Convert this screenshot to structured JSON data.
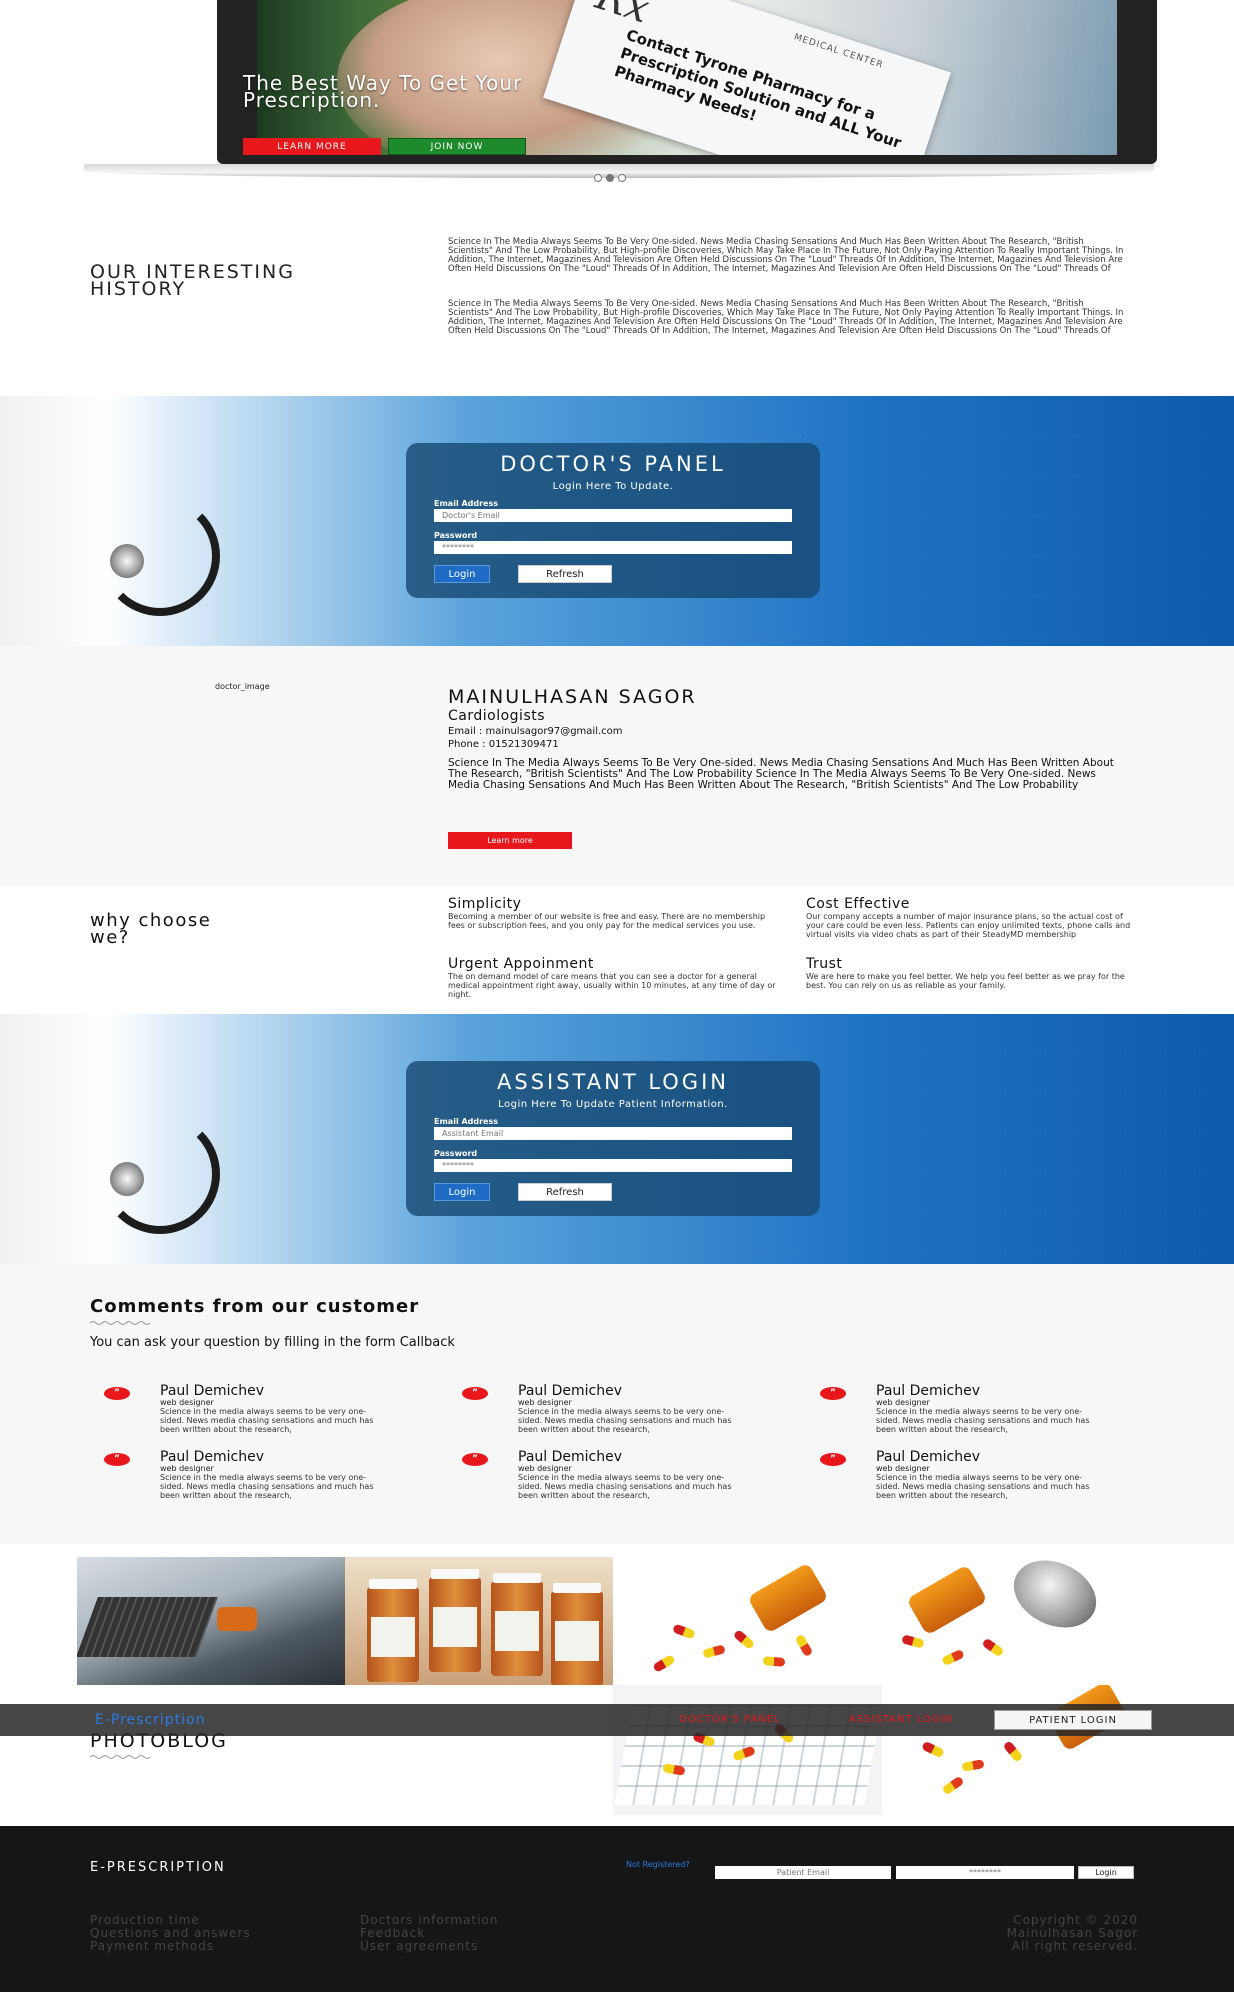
{
  "hero": {
    "title": "The Best Way To Get Your Prescription.",
    "rx_symbol": "Rx",
    "rx_header": "MEDICAL CENTER",
    "rx_text": "Contact Tyrone Pharmacy for a Prescription Solution and ALL Your Pharmacy Needs!",
    "learn_more": "LEARN MORE",
    "join_now": "JOIN NOW",
    "slides": [
      false,
      true,
      false
    ]
  },
  "history": {
    "title": "OUR INTERESTING HISTORY",
    "paragraphs": [
      "Science In The Media Always Seems To Be Very One-sided. News Media Chasing Sensations And Much Has Been Written About The Research, \"British Scientists\" And The Low Probability, But High-profile Discoveries, Which May Take Place In The Future, Not Only Paying Attention To Really Important Things. In Addition, The Internet, Magazines And Television Are Often Held Discussions On The \"Loud\" Threads Of In Addition, The Internet, Magazines And Television Are Often Held Discussions On The \"Loud\" Threads Of In Addition, The Internet, Magazines And Television Are Often Held Discussions On The \"Loud\" Threads Of",
      "Science In The Media Always Seems To Be Very One-sided. News Media Chasing Sensations And Much Has Been Written About The Research, \"British Scientists\" And The Low Probability, But High-profile Discoveries, Which May Take Place In The Future, Not Only Paying Attention To Really Important Things. In Addition, The Internet, Magazines And Television Are Often Held Discussions On The \"Loud\" Threads Of In Addition, The Internet, Magazines And Television Are Often Held Discussions On The \"Loud\" Threads Of In Addition, The Internet, Magazines And Television Are Often Held Discussions On The \"Loud\" Threads Of"
    ]
  },
  "doctor_panel": {
    "title": "DOCTOR'S PANEL",
    "subtitle": "Login Here To Update.",
    "email_label": "Email Address",
    "email_placeholder": "Doctor's Email",
    "password_label": "Password",
    "password_placeholder": "********",
    "login": "Login",
    "refresh": "Refresh"
  },
  "doctor": {
    "image_alt": "doctor_image",
    "name": "MAINULHASAN SAGOR",
    "specialty": "Cardiologists",
    "email": "Email : mainulsagor97@gmail.com",
    "phone": "Phone : 01521309471",
    "bio": "Science In The Media Always Seems To Be Very One-sided. News Media Chasing Sensations And Much Has Been Written About The Research, \"British Scientists\" And The Low Probability Science In The Media Always Seems To Be Very One-sided. News Media Chasing Sensations And Much Has Been Written About The Research, \"British Scientists\" And The Low Probability",
    "learn_more": "Learn more"
  },
  "why": {
    "title": "why choose we?",
    "features": [
      {
        "title": "Simplicity",
        "text": "Becoming a member of our website is free and easy. There are no membership fees or subscription fees, and you only pay for the medical services you use."
      },
      {
        "title": "Cost Effective",
        "text": "Our company accepts a number of major insurance plans, so the actual cost of your care could be even less. Patients can enjoy unlimited texts, phone calls and virtual visits via video chats as part of their SteadyMD membership"
      },
      {
        "title": "Urgent Appoinment",
        "text": "The on demand model of care means that you can see a doctor for a general medical appointment right away, usually within 10 minutes, at any time of day or night."
      },
      {
        "title": "Trust",
        "text": "We are here to make you feel better. We help you feel better as we pray for the best. You can rely on us as reliable as your family."
      }
    ]
  },
  "assistant_panel": {
    "title": "ASSISTANT LOGIN",
    "subtitle": "Login Here To Update Patient Information.",
    "email_label": "Email Address",
    "email_placeholder": "Assistant Email",
    "password_label": "Password",
    "password_placeholder": "********",
    "login": "Login",
    "refresh": "Refresh"
  },
  "comments": {
    "title": "Comments from our customer",
    "subtitle": "You can ask your question by filling in the form Callback",
    "quote_icon": "quote-icon",
    "items": [
      {
        "name": "Paul Demichev",
        "role": "web designer",
        "text": "Science in the media always seems to be very one-sided. News media chasing sensations and much has been written about the research,"
      },
      {
        "name": "Paul Demichev",
        "role": "web designer",
        "text": "Science in the media always seems to be very one-sided. News media chasing sensations and much has been written about the research,"
      },
      {
        "name": "Paul Demichev",
        "role": "web designer",
        "text": "Science in the media always seems to be very one-sided. News media chasing sensations and much has been written about the research,"
      },
      {
        "name": "Paul Demichev",
        "role": "web designer",
        "text": "Science in the media always seems to be very one-sided. News media chasing sensations and much has been written about the research,"
      },
      {
        "name": "Paul Demichev",
        "role": "web designer",
        "text": "Science in the media always seems to be very one-sided. News media chasing sensations and much has been written about the research,"
      },
      {
        "name": "Paul Demichev",
        "role": "web designer",
        "text": "Science in the media always seems to be very one-sided. News media chasing sensations and much has been written about the research,"
      }
    ]
  },
  "photoblog": {
    "title": "PHOTOBLOG"
  },
  "navbar": {
    "brand": "E-Prescription",
    "links": [
      "DOCTOR'S PANEL",
      "ASSISTANT LOGIN",
      "PATIENT LOGIN"
    ]
  },
  "footer": {
    "brand": "E-PRESCRIPTION",
    "not_registered": "Not Registered?",
    "email_placeholder": "Patient Email",
    "password_placeholder": "********",
    "login": "Login",
    "col1": [
      "Production time",
      "Questions and answers",
      "Payment methods"
    ],
    "col2": [
      "Doctors information",
      "Feedback",
      "User agreements"
    ],
    "copyright": [
      "Copyright © 2020",
      "Mainulhasan Sagor",
      "All right reserved."
    ]
  },
  "colors": {
    "accent_red": "#e8171c",
    "accent_green": "#1d8a2b",
    "link_blue": "#2c7be5",
    "footer_bg": "#161616"
  }
}
